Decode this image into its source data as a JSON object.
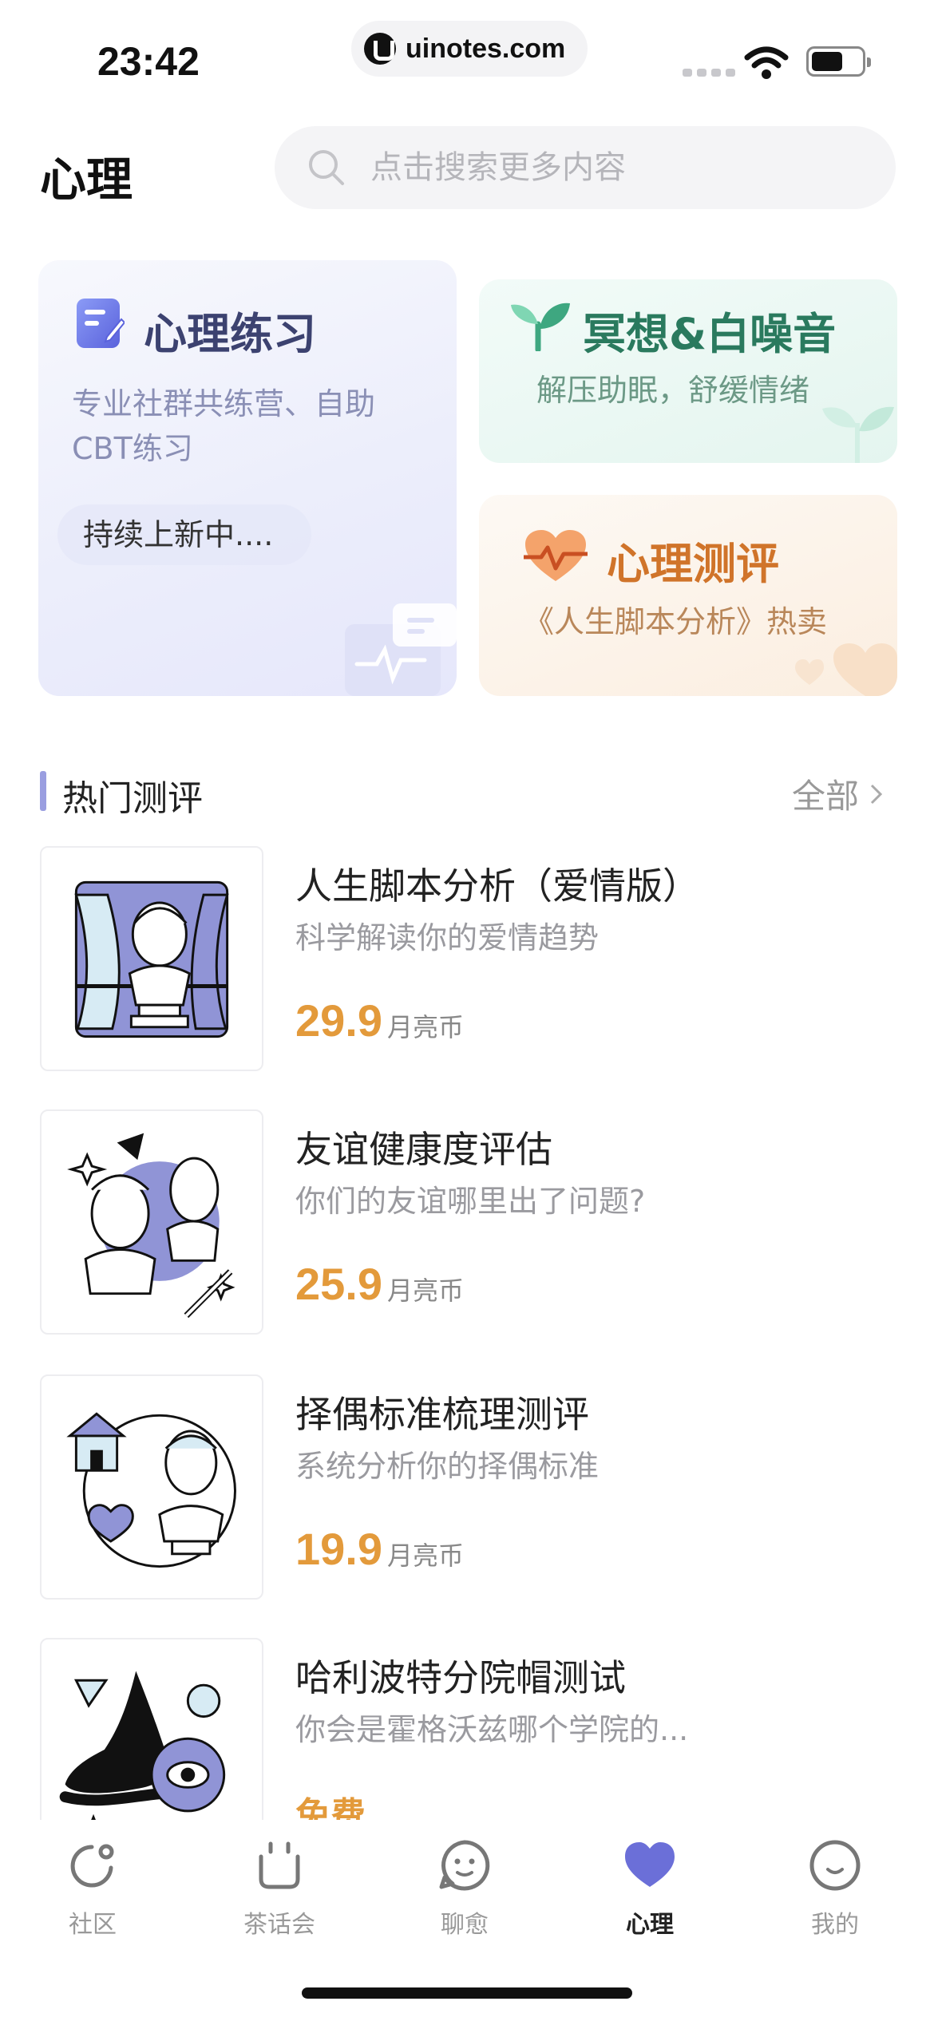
{
  "status_bar": {
    "time": "23:42",
    "url": "uinotes.com"
  },
  "header": {
    "title": "心理",
    "search_placeholder": "点击搜索更多内容"
  },
  "cards": {
    "practice": {
      "title": "心理练习",
      "subtitle": "专业社群共练营、自助CBT练习",
      "chip": "持续上新中...."
    },
    "meditate": {
      "title": "冥想&白噪音",
      "subtitle": "解压助眠，舒缓情绪"
    },
    "test": {
      "title": "心理测评",
      "subtitle": "《人生脚本分析》热卖"
    }
  },
  "section": {
    "title": "热门测评",
    "all_label": "全部"
  },
  "items": [
    {
      "title": "人生脚本分析（爱情版）",
      "subtitle": "科学解读你的爱情趋势",
      "price": "29.9",
      "unit": "月亮币"
    },
    {
      "title": "友谊健康度评估",
      "subtitle": "你们的友谊哪里出了问题?",
      "price": "25.9",
      "unit": "月亮币"
    },
    {
      "title": "择偶标准梳理测评",
      "subtitle": "系统分析你的择偶标准",
      "price": "19.9",
      "unit": "月亮币"
    },
    {
      "title": "哈利波特分院帽测试",
      "subtitle": "你会是霍格沃兹哪个学院的...",
      "price_label": "免费"
    }
  ],
  "tabs": [
    {
      "label": "社区",
      "icon": "community-icon"
    },
    {
      "label": "茶话会",
      "icon": "tea-cup-icon"
    },
    {
      "label": "聊愈",
      "icon": "chat-face-icon"
    },
    {
      "label": "心理",
      "icon": "heart-icon",
      "active": true
    },
    {
      "label": "我的",
      "icon": "profile-face-icon"
    }
  ],
  "colors": {
    "accent": "#6b6fd8",
    "price": "#e39a3b",
    "meditate": "#2a7a5e",
    "test": "#d0742a"
  }
}
